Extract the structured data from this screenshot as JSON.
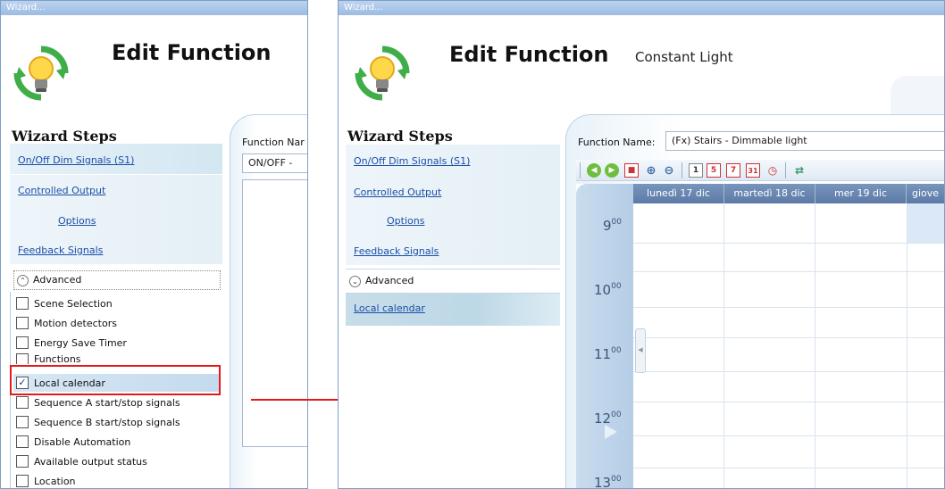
{
  "left_window": {
    "title": "Wizard...",
    "header_title": "Edit Function",
    "steps_title": "Wizard Steps",
    "steps": [
      {
        "label": "On/Off Dim Signals (S1)"
      },
      {
        "label": "Controlled Output"
      },
      {
        "label": "Options"
      },
      {
        "label": "Feedback Signals"
      }
    ],
    "advanced_label": "Advanced",
    "advanced_icon": "chevron-up-icon",
    "checkboxes": [
      {
        "label": "Scene Selection",
        "checked": false
      },
      {
        "label": "Motion detectors",
        "checked": false
      },
      {
        "label": "Energy Save Timer",
        "checked": false
      },
      {
        "label": "Functions",
        "checked": false
      },
      {
        "label": "Local calendar",
        "checked": true
      },
      {
        "label": "Sequence A start/stop signals",
        "checked": false
      },
      {
        "label": "Sequence B start/stop signals",
        "checked": false
      },
      {
        "label": "Disable Automation",
        "checked": false
      },
      {
        "label": "Available output status",
        "checked": false
      },
      {
        "label": "Location",
        "checked": false
      }
    ],
    "function_name_label": "Function Nar",
    "function_name_value": "ON/OFF -"
  },
  "right_window": {
    "title": "Wizard...",
    "header_title": "Edit Function",
    "subtitle": "Constant Light",
    "steps_title": "Wizard Steps",
    "steps": [
      {
        "label": "On/Off Dim Signals (S1)"
      },
      {
        "label": "Controlled Output"
      },
      {
        "label": "Options"
      },
      {
        "label": "Feedback Signals"
      }
    ],
    "advanced_label": "Advanced",
    "advanced_icon": "chevron-down-icon",
    "selected_step": "Local calendar",
    "function_name_label": "Function Name:",
    "function_name_value": "(Fx) Stairs - Dimmable light",
    "toolbar": [
      {
        "icon": "back-icon"
      },
      {
        "icon": "forward-icon"
      },
      {
        "icon": "today-icon"
      },
      {
        "icon": "zoom-in-icon"
      },
      {
        "icon": "zoom-out-icon"
      },
      {
        "icon": "day-view-icon",
        "text": "1"
      },
      {
        "icon": "work-week-view-icon",
        "text": "5"
      },
      {
        "icon": "week-view-icon",
        "text": "7"
      },
      {
        "icon": "month-view-icon",
        "text": "31"
      },
      {
        "icon": "timeline-view-icon"
      },
      {
        "icon": "fullscreen-icon"
      }
    ],
    "calendar": {
      "days": [
        "lunedì 17 dic",
        "martedì 18 dic",
        "mer 19 dic",
        "giove"
      ],
      "hours": [
        {
          "h": "9",
          "m": "00"
        },
        {
          "h": "10",
          "m": "00"
        },
        {
          "h": "11",
          "m": "00"
        },
        {
          "h": "12",
          "m": "00"
        },
        {
          "h": "13",
          "m": "00"
        }
      ]
    }
  },
  "colors": {
    "highlight": "#e11b1b",
    "link": "#1a4fa8",
    "calendar_header": "#6a88b3",
    "time_column": "#bfd4ea"
  }
}
